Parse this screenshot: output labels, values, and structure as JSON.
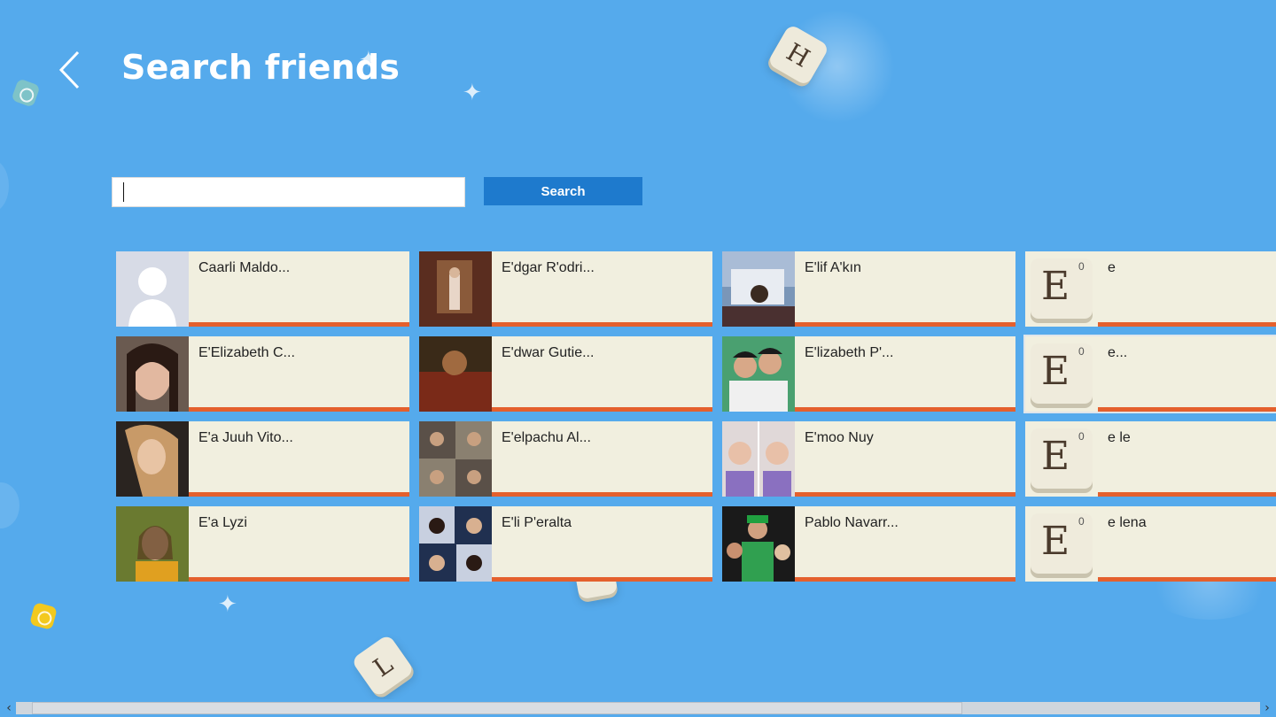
{
  "header": {
    "title": "Search friends",
    "back_icon": "chevron-left-icon"
  },
  "search": {
    "value": "",
    "placeholder": "",
    "button_label": "Search"
  },
  "friends": [
    {
      "name": "Caarli Maldo...",
      "avatar": "default-silhouette"
    },
    {
      "name": "E'dgar R'odri...",
      "avatar": "photo"
    },
    {
      "name": "E'lif A'kın",
      "avatar": "photo"
    },
    {
      "name": "e",
      "avatar": "letter-tile",
      "letter": "E",
      "points": "0"
    },
    {
      "name": "E'Elizabeth C...",
      "avatar": "photo"
    },
    {
      "name": "E'dwar Gutie...",
      "avatar": "photo"
    },
    {
      "name": "E'lizabeth P'...",
      "avatar": "photo"
    },
    {
      "name": "e...",
      "avatar": "letter-tile",
      "letter": "E",
      "points": "0"
    },
    {
      "name": "E'a Juuh Vito...",
      "avatar": "photo"
    },
    {
      "name": "E'elpachu Al...",
      "avatar": "photo"
    },
    {
      "name": "E'moo Nuy",
      "avatar": "photo"
    },
    {
      "name": "e le",
      "avatar": "letter-tile",
      "letter": "E",
      "points": "0"
    },
    {
      "name": "E'a Lyzi",
      "avatar": "photo"
    },
    {
      "name": "E'li P'eralta",
      "avatar": "photo"
    },
    {
      "name": "Pablo Navarr...",
      "avatar": "photo"
    },
    {
      "name": "e lena",
      "avatar": "letter-tile",
      "letter": "E",
      "points": "0"
    }
  ],
  "background_tiles": [
    {
      "letter": "H"
    },
    {
      "letter": "L"
    }
  ],
  "colors": {
    "background": "#55aaec",
    "card": "#f1efdf",
    "accent_bar": "#e4602d",
    "search_button": "#1e7acd"
  }
}
